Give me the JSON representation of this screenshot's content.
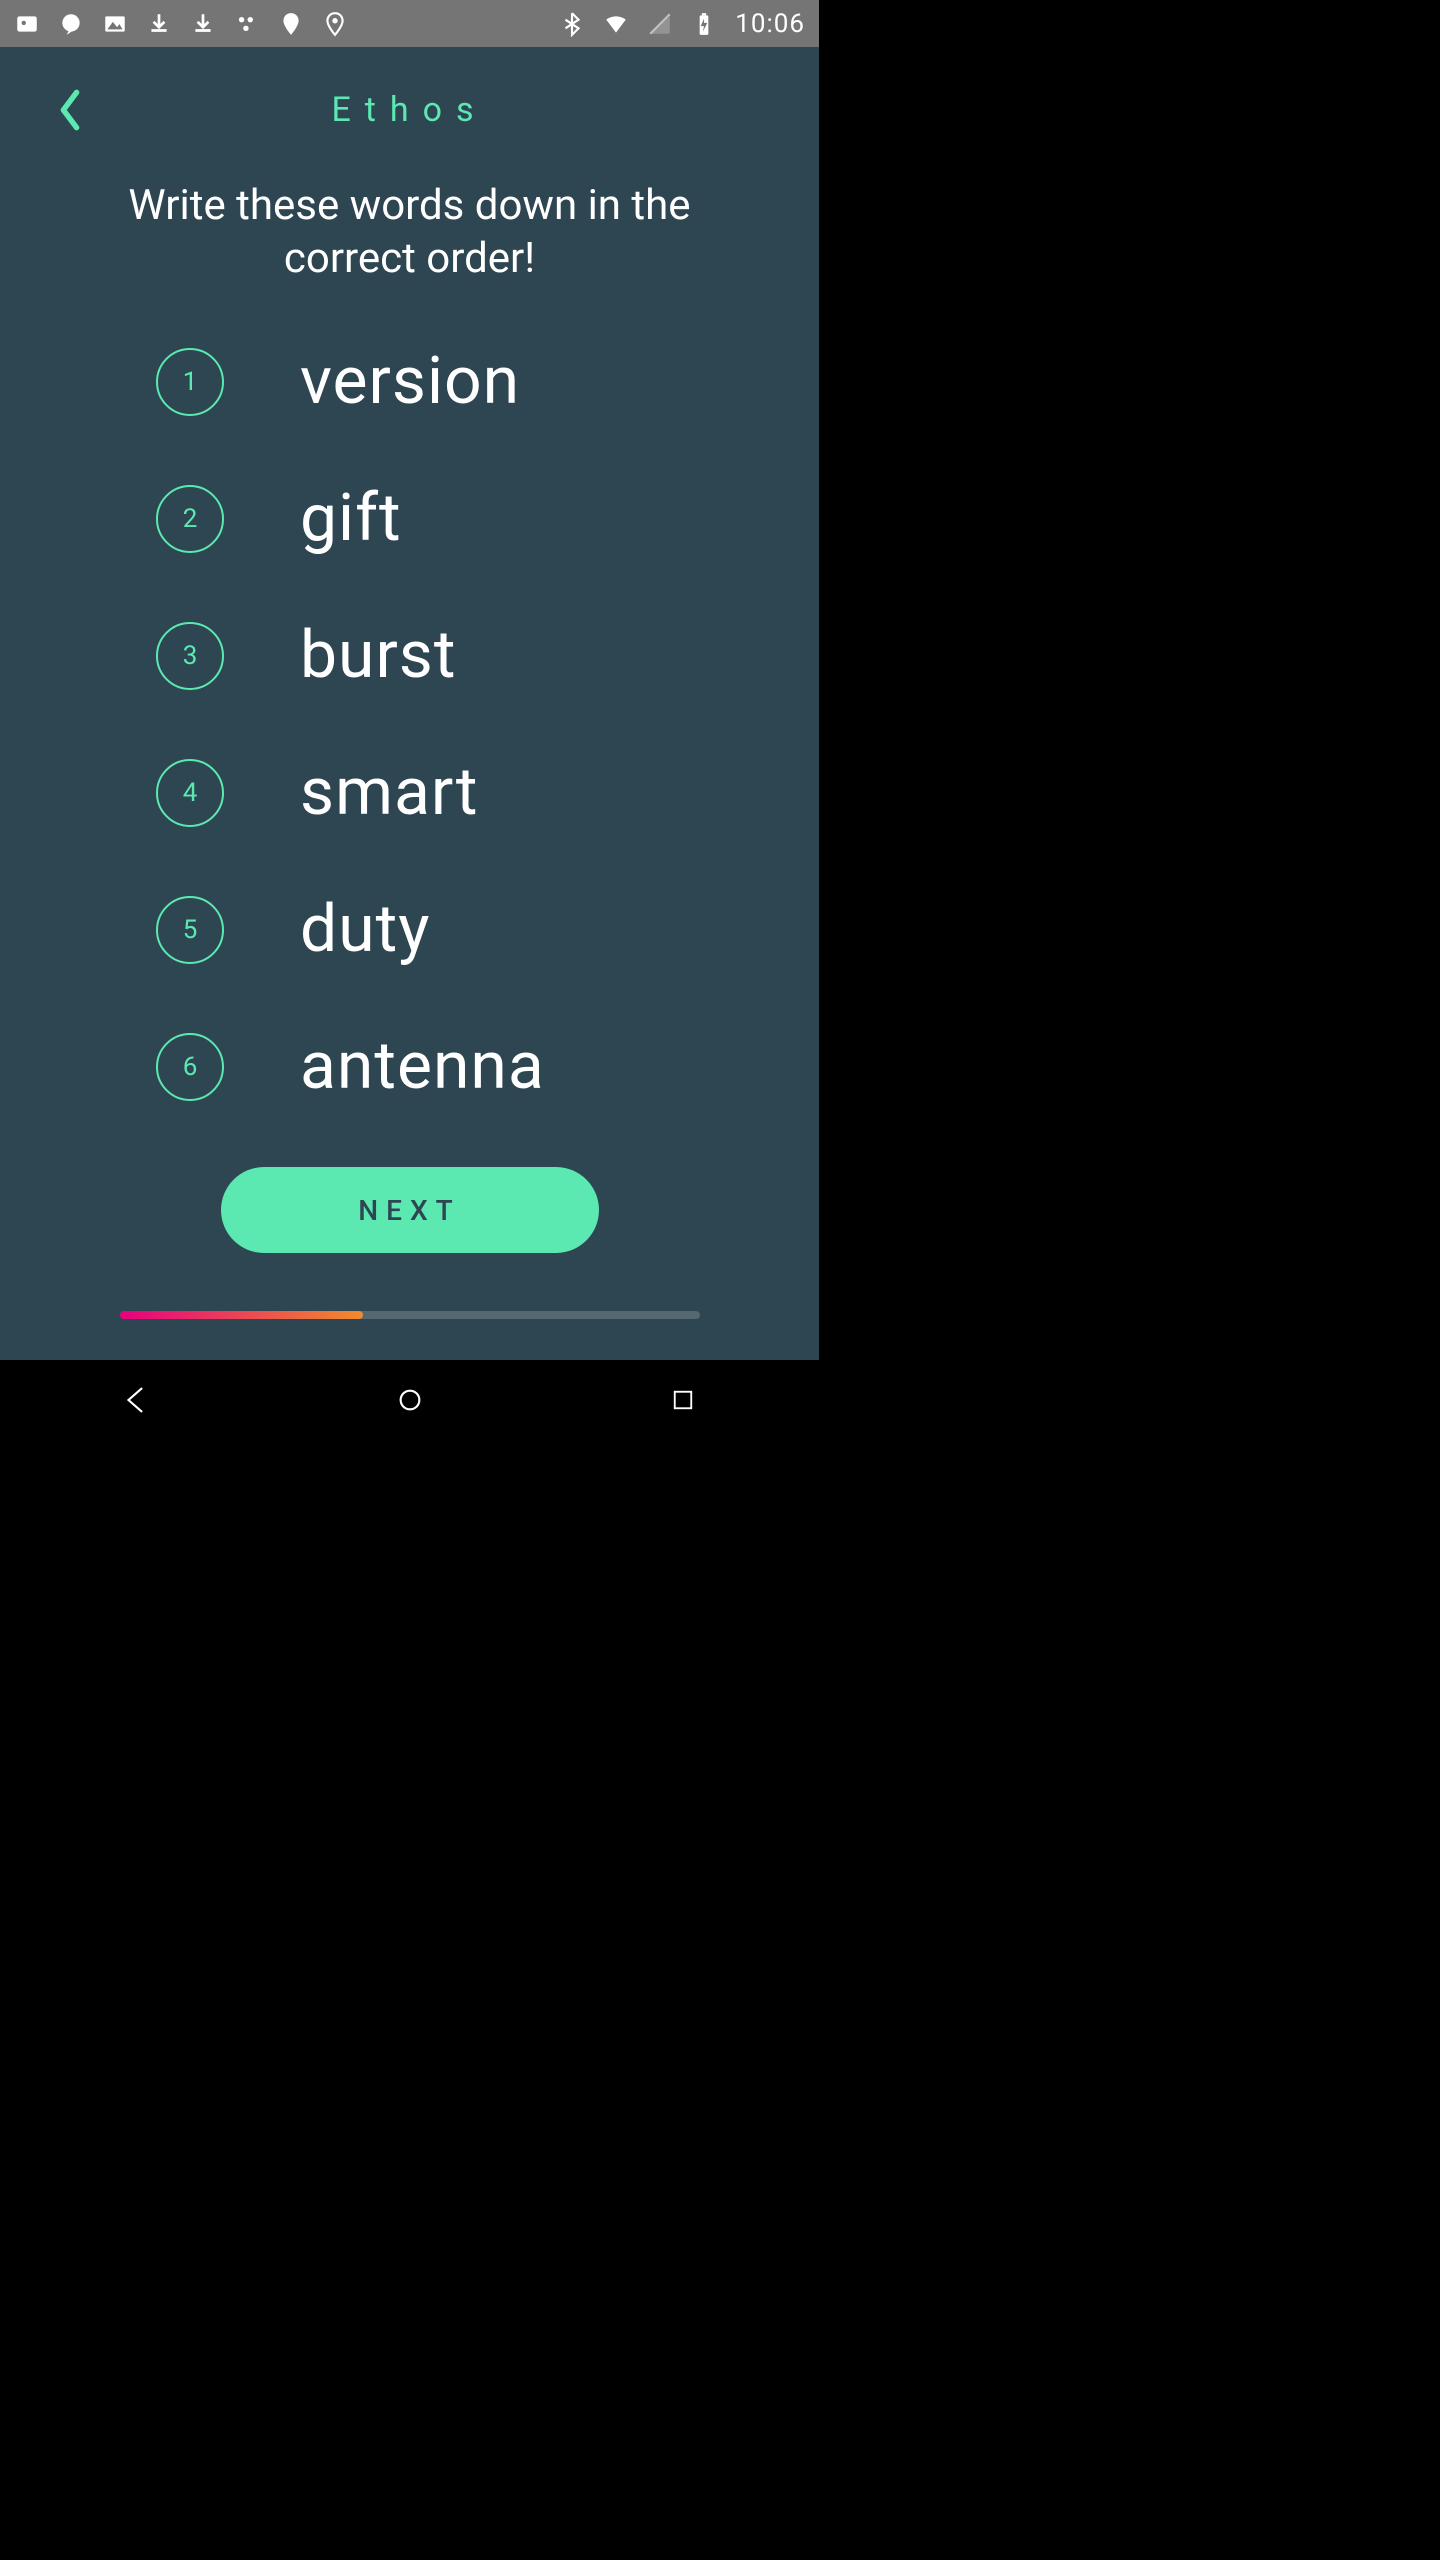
{
  "status_bar": {
    "time": "10:06"
  },
  "topbar": {
    "title": "Ethos"
  },
  "instruction": "Write these words down in the correct order!",
  "words": [
    {
      "num": "1",
      "text": "version"
    },
    {
      "num": "2",
      "text": "gift"
    },
    {
      "num": "3",
      "text": "burst"
    },
    {
      "num": "4",
      "text": "smart"
    },
    {
      "num": "5",
      "text": "duty"
    },
    {
      "num": "6",
      "text": "antenna"
    }
  ],
  "next_label": "NEXT",
  "progress_percent": 42
}
